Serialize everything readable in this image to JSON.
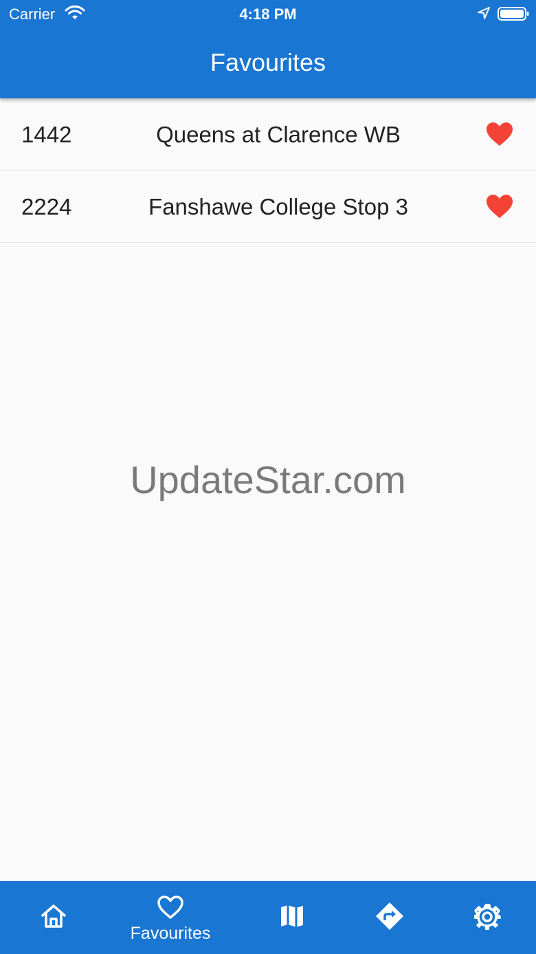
{
  "status_bar": {
    "carrier": "Carrier",
    "time": "4:18 PM"
  },
  "app_bar": {
    "title": "Favourites",
    "color": "#1976d2"
  },
  "favourites": [
    {
      "stop_id": "1442",
      "name": "Queens at Clarence WB",
      "icon": "heart-icon"
    },
    {
      "stop_id": "2224",
      "name": "Fanshawe College Stop 3",
      "icon": "heart-icon"
    }
  ],
  "watermark": "UpdateStar.com",
  "bottom_nav": {
    "items": [
      {
        "icon": "home-icon",
        "label": ""
      },
      {
        "icon": "heart-outline-icon",
        "label": "Favourites",
        "active": true
      },
      {
        "icon": "map-icon",
        "label": ""
      },
      {
        "icon": "directions-icon",
        "label": ""
      },
      {
        "icon": "gear-icon",
        "label": ""
      }
    ]
  },
  "colors": {
    "heart": "#f44336",
    "primary": "#1976d2"
  }
}
